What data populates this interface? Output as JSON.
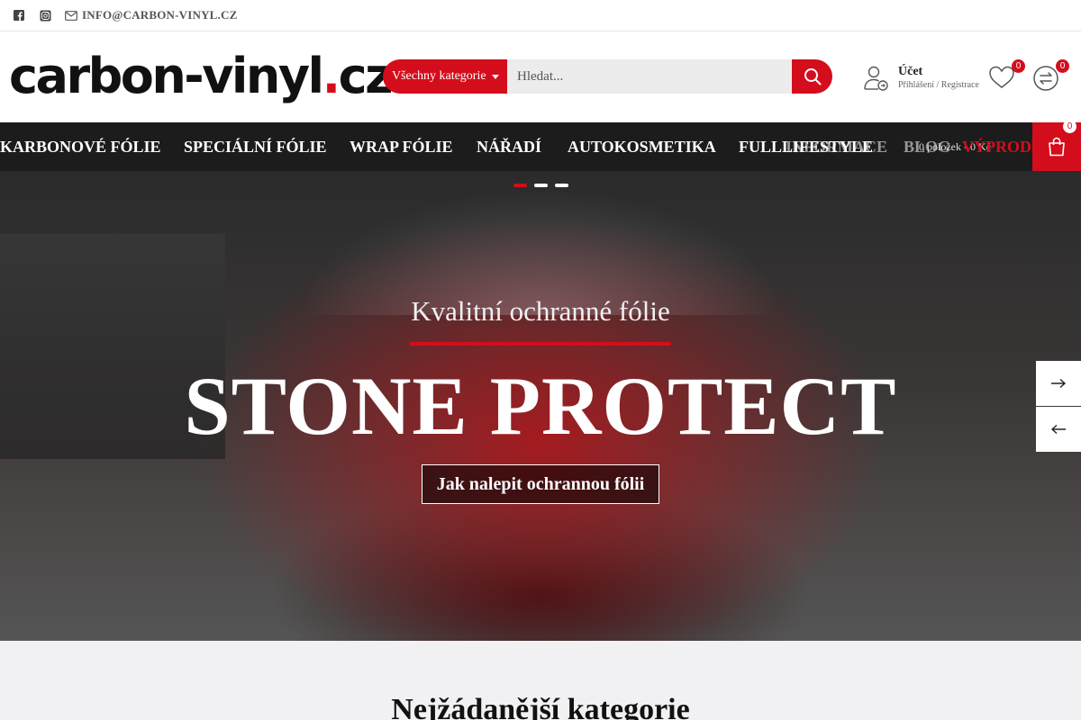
{
  "topbar": {
    "email": "INFO@CARBON-VINYL.CZ",
    "social": [
      "facebook-icon",
      "instagram-icon"
    ]
  },
  "header": {
    "logo_main": "carbon-vinyl",
    "logo_dot": ".",
    "logo_tld": "cz",
    "search": {
      "category": "Všechny kategorie",
      "placeholder": "Hledat..."
    },
    "account": {
      "title": "Účet",
      "subtitle": "Přihlášení / Registrace"
    },
    "wishlist_count": "0",
    "compare_count": "0"
  },
  "nav": {
    "items": [
      "KARBONOVÉ FÓLIE",
      "SPECIÁLNÍ FÓLIE",
      "WRAP FÓLIE",
      "NÁŘADÍ",
      "AUTOKOSMETIKA",
      "FULLLIFESTYLE"
    ],
    "overlap": {
      "info": "INFORMACE",
      "blog": "BLOG",
      "cart_text": "0 položek - 0 Kč",
      "sale": "VÝPRODEJ",
      "info_small": "INFO"
    },
    "cart_count": "0"
  },
  "hero": {
    "subtitle": "Kvalitní ochranné fólie",
    "title": "STONE PROTECT",
    "cta": "Jak nalepit ochrannou fólii",
    "slides": 3,
    "active_slide": 1
  },
  "section": {
    "heading": "Nejžádanější kategorie"
  },
  "colors": {
    "accent": "#d40d1c",
    "nav_bg": "#1c1c1c"
  }
}
